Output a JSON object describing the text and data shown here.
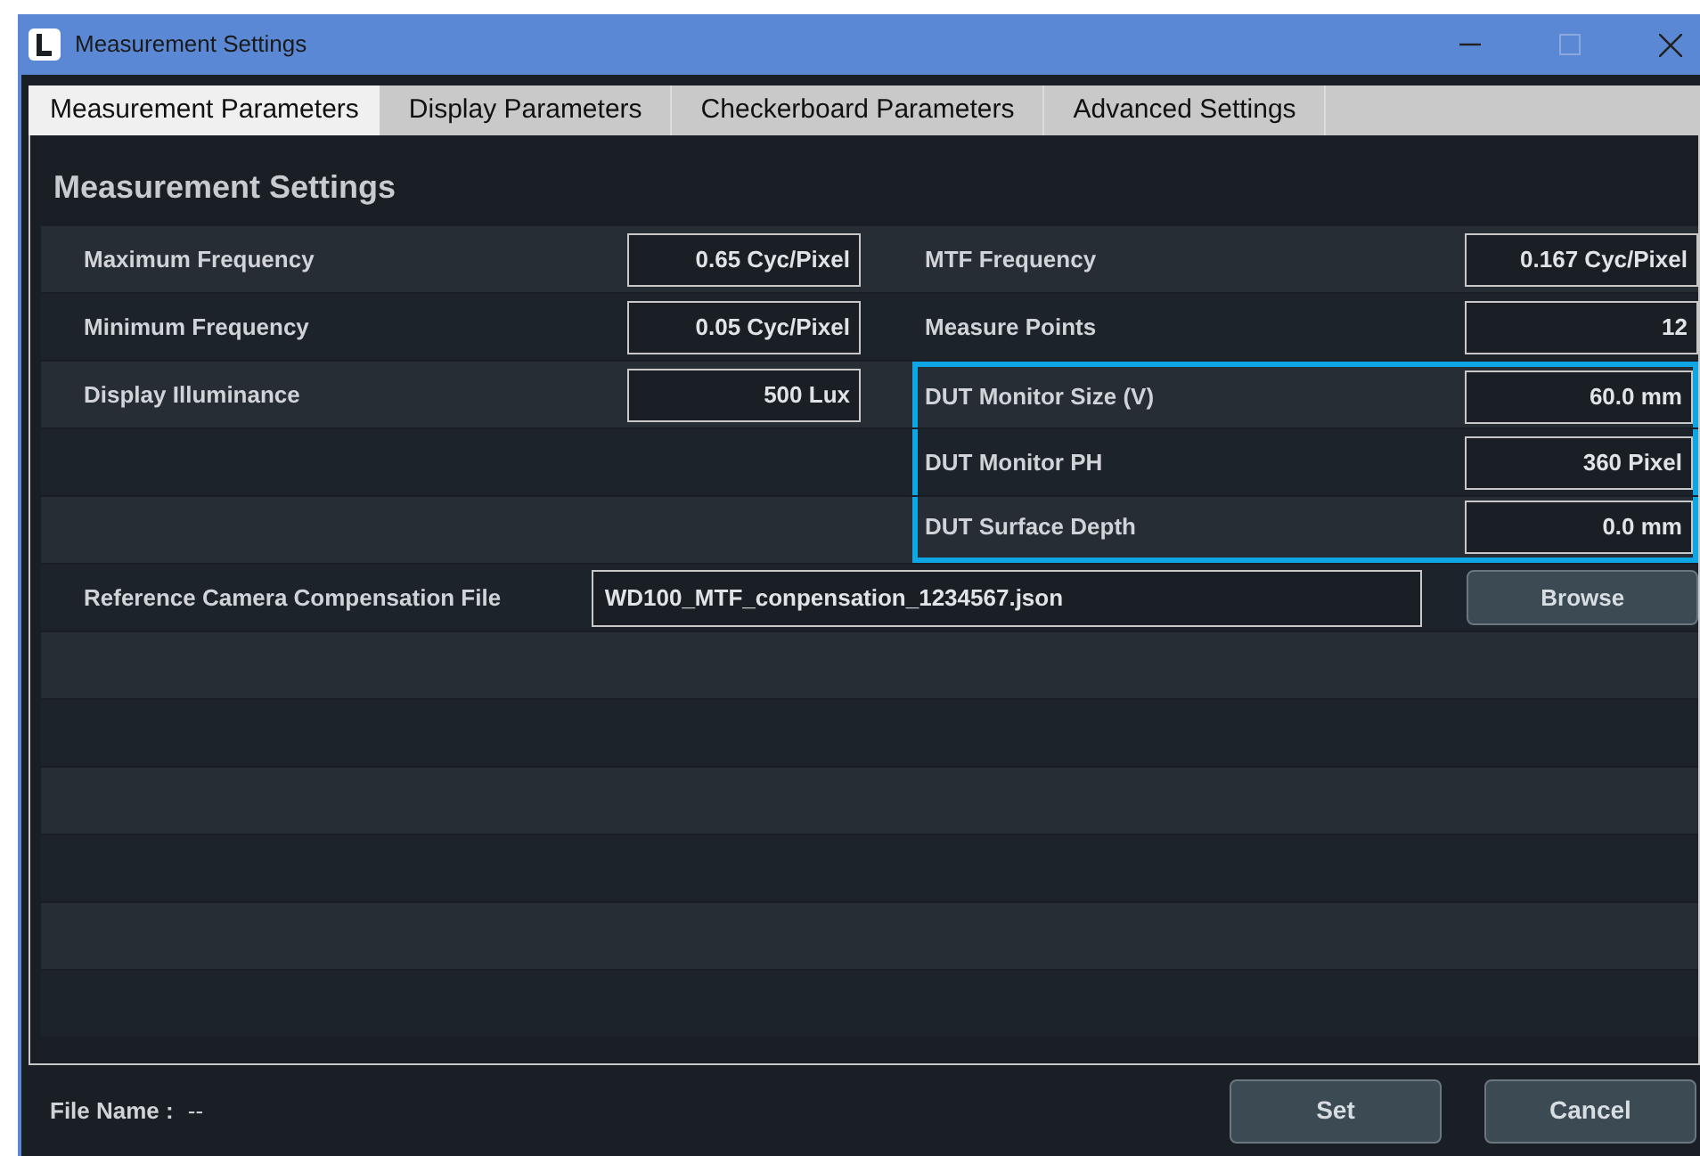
{
  "window": {
    "title": "Measurement Settings"
  },
  "tabs": [
    {
      "label": "Measurement Parameters",
      "selected": true
    },
    {
      "label": "Display Parameters",
      "selected": false
    },
    {
      "label": "Checkerboard Parameters",
      "selected": false
    },
    {
      "label": "Advanced Settings",
      "selected": false
    }
  ],
  "section_title": "Measurement Settings",
  "rows": [
    {
      "left": {
        "label": "Maximum Frequency",
        "value": "0.65 Cyc/Pixel"
      },
      "right": {
        "label": "MTF Frequency",
        "value": "0.167 Cyc/Pixel",
        "highlighted": false
      }
    },
    {
      "left": {
        "label": "Minimum Frequency",
        "value": "0.05 Cyc/Pixel"
      },
      "right": {
        "label": "Measure Points",
        "value": "12",
        "highlighted": false
      }
    },
    {
      "left": {
        "label": "Display Illuminance",
        "value": "500 Lux"
      },
      "right": {
        "label": "DUT Monitor Size (V)",
        "value": "60.0 mm",
        "highlighted": true
      }
    },
    {
      "right": {
        "label": "DUT Monitor PH",
        "value": "360 Pixel",
        "highlighted": true
      }
    },
    {
      "right": {
        "label": "DUT Surface Depth",
        "value": "0.0 mm",
        "highlighted": true
      }
    }
  ],
  "compensation_file": {
    "label": "Reference Camera Compensation File",
    "value": "WD100_MTF_conpensation_1234567.json",
    "button": "Browse"
  },
  "footer": {
    "file_name_label": "File Name :",
    "file_name": "--",
    "buttons": [
      "Set",
      "Cancel"
    ]
  }
}
